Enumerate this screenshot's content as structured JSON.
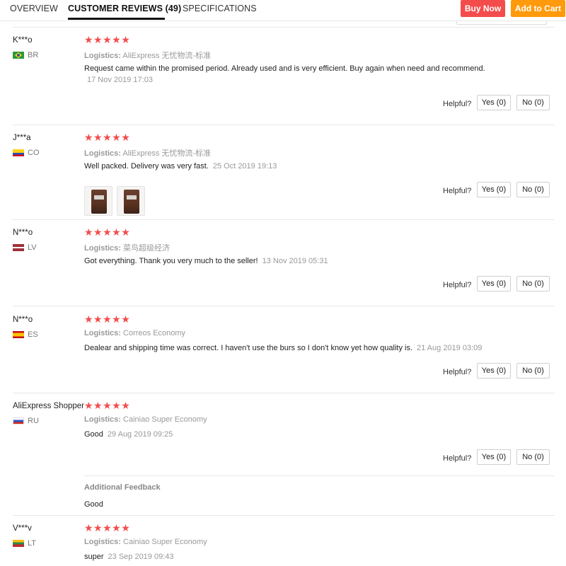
{
  "tabs": [
    {
      "label": "OVERVIEW"
    },
    {
      "label": "CUSTOMER REVIEWS (49)"
    },
    {
      "label": "SPECIFICATIONS"
    }
  ],
  "actions": {
    "buy_now": "Buy Now",
    "add_to_cart": "Add to Cart"
  },
  "colors": {
    "accent_red": "#f44c4c",
    "accent_orange": "#ff9a0c",
    "star_color": "#f44c4c"
  },
  "stars": "★★★★★",
  "helpful_label": "Helpful?",
  "logistics_label": "Logistics:",
  "reviews": [
    {
      "user": "K***o",
      "country": "BR",
      "rating": 5,
      "logistics": "AliExpress 无忧物流-标准",
      "text": "Request came within the promised period. Already used and is very efficient. Buy again when need and recommend.",
      "date": "17 Nov 2019 17:03",
      "yes": "Yes (0)",
      "no": "No (0)"
    },
    {
      "user": "J***a",
      "country": "CO",
      "rating": 5,
      "logistics": "AliExpress 无忧物流-标准",
      "text": "Well packed. Delivery was very fast.",
      "date": "25 Oct 2019 19:13",
      "yes": "Yes (0)",
      "no": "No (0)",
      "photos": 2
    },
    {
      "user": "N***o",
      "country": "LV",
      "rating": 5,
      "logistics": "菜鸟超级经济",
      "text": "Got everything. Thank you very much to the seller!",
      "date": "13 Nov 2019 05:31",
      "yes": "Yes (0)",
      "no": "No (0)"
    },
    {
      "user": "N***o",
      "country": "ES",
      "rating": 5,
      "logistics": "Correos Economy",
      "text": "Dealear and shipping time was correct. I haven't use the burs so I don't know yet how quality is.",
      "date": "21 Aug 2019 03:09",
      "yes": "Yes (0)",
      "no": "No (0)"
    },
    {
      "user": "AliExpress Shopper",
      "country": "RU",
      "rating": 5,
      "logistics": "Cainiao Super Economy",
      "text": "Good",
      "date": "29 Aug 2019 09:25",
      "yes": "Yes (0)",
      "no": "No (0)",
      "additional_feedback_label": "Additional Feedback",
      "additional_feedback": "Good"
    },
    {
      "user": "V***v",
      "country": "LT",
      "rating": 5,
      "logistics": "Cainiao Super Economy",
      "text": "super",
      "date": "23 Sep 2019 09:43"
    }
  ]
}
